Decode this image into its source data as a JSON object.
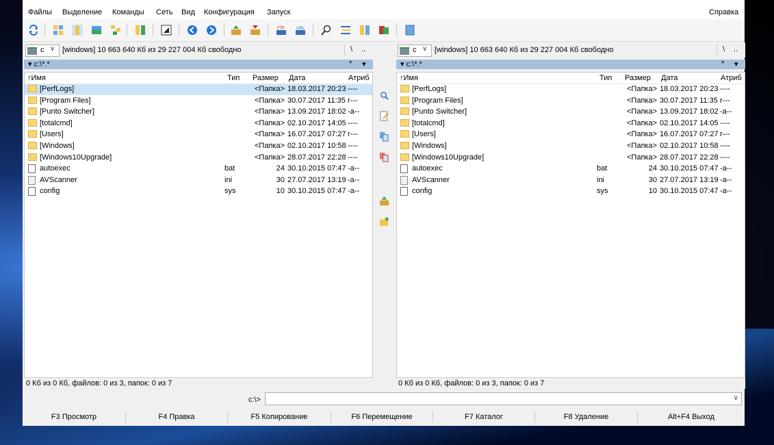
{
  "menu": {
    "files": "Файлы",
    "selection": "Выделение",
    "commands": "Команды",
    "network": "Сеть",
    "view": "Вид",
    "configuration": "Конфигурация",
    "launch": "Запуск",
    "help": "Справка"
  },
  "left_panel": {
    "drive": "c",
    "free_space": "[windows]  10 663 640 Кб из 29 227 004 Кб свободно",
    "root": "\\",
    "up": "..",
    "path": "c:\\*.*",
    "filter": "*",
    "headers": {
      "name": "Имя",
      "ext": "Тип",
      "size": "Размер",
      "date": "Дата",
      "attr": "Атриб"
    },
    "rows": [
      {
        "name": "[PerfLogs]",
        "ext": "",
        "size": "<Папка>",
        "date": "18.03.2017 20:23",
        "attr": "----",
        "icon": "folder-icon"
      },
      {
        "name": "[Program Files]",
        "ext": "",
        "size": "<Папка>",
        "date": "30.07.2017 11:35",
        "attr": "r---",
        "icon": "folder-icon"
      },
      {
        "name": "[Punto Switcher]",
        "ext": "",
        "size": "<Папка>",
        "date": "13.09.2017 18:02",
        "attr": "-a--",
        "icon": "folder-icon"
      },
      {
        "name": "[totalcmd]",
        "ext": "",
        "size": "<Папка>",
        "date": "02.10.2017 14:05",
        "attr": "----",
        "icon": "folder-icon"
      },
      {
        "name": "[Users]",
        "ext": "",
        "size": "<Папка>",
        "date": "16.07.2017 07:27",
        "attr": "r---",
        "icon": "folder-icon"
      },
      {
        "name": "[Windows]",
        "ext": "",
        "size": "<Папка>",
        "date": "02.10.2017 10:58",
        "attr": "----",
        "icon": "folder-icon"
      },
      {
        "name": "[Windows10Upgrade]",
        "ext": "",
        "size": "<Папка>",
        "date": "28.07.2017 22:28",
        "attr": "----",
        "icon": "folder-icon"
      },
      {
        "name": "autoexec",
        "ext": "bat",
        "size": "24",
        "date": "30.10.2015 07:47",
        "attr": "-a--",
        "icon": "batch-file-icon"
      },
      {
        "name": "AVScanner",
        "ext": "ini",
        "size": "30",
        "date": "27.07.2017 13:19",
        "attr": "-a--",
        "icon": "settings-file-icon"
      },
      {
        "name": "config",
        "ext": "sys",
        "size": "10",
        "date": "30.10.2015 07:47",
        "attr": "-a--",
        "icon": "file-icon"
      }
    ],
    "status": "0 Кб из 0 Кб, файлов: 0 из 3, папок: 0 из 7"
  },
  "right_panel": {
    "drive": "c",
    "free_space": "[windows]  10 663 640 Кб из 29 227 004 Кб свободно",
    "root": "\\",
    "up": "..",
    "path": "c:\\*.*",
    "filter": "*",
    "headers": {
      "name": "Имя",
      "ext": "Тип",
      "size": "Размер",
      "date": "Дата",
      "attr": "Атриб"
    },
    "rows": [
      {
        "name": "[PerfLogs]",
        "ext": "",
        "size": "<Папка>",
        "date": "18.03.2017 20:23",
        "attr": "----",
        "icon": "folder-icon"
      },
      {
        "name": "[Program Files]",
        "ext": "",
        "size": "<Папка>",
        "date": "30.07.2017 11:35",
        "attr": "r---",
        "icon": "folder-icon"
      },
      {
        "name": "[Punto Switcher]",
        "ext": "",
        "size": "<Папка>",
        "date": "13.09.2017 18:02",
        "attr": "-a--",
        "icon": "folder-icon"
      },
      {
        "name": "[totalcmd]",
        "ext": "",
        "size": "<Папка>",
        "date": "02.10.2017 14:05",
        "attr": "----",
        "icon": "folder-icon"
      },
      {
        "name": "[Users]",
        "ext": "",
        "size": "<Папка>",
        "date": "16.07.2017 07:27",
        "attr": "r---",
        "icon": "folder-icon"
      },
      {
        "name": "[Windows]",
        "ext": "",
        "size": "<Папка>",
        "date": "02.10.2017 10:58",
        "attr": "----",
        "icon": "folder-icon"
      },
      {
        "name": "[Windows10Upgrade]",
        "ext": "",
        "size": "<Папка>",
        "date": "28.07.2017 22:28",
        "attr": "----",
        "icon": "folder-icon"
      },
      {
        "name": "autoexec",
        "ext": "bat",
        "size": "24",
        "date": "30.10.2015 07:47",
        "attr": "-a--",
        "icon": "batch-file-icon"
      },
      {
        "name": "AVScanner",
        "ext": "ini",
        "size": "30",
        "date": "27.07.2017 13:19",
        "attr": "-a--",
        "icon": "settings-file-icon"
      },
      {
        "name": "config",
        "ext": "sys",
        "size": "10",
        "date": "30.10.2015 07:47",
        "attr": "-a--",
        "icon": "file-icon"
      }
    ],
    "status": "0 Кб из 0 Кб, файлов: 0 из 3, папок: 0 из 7"
  },
  "command_line": {
    "prompt": "c:\\>"
  },
  "fkeys": {
    "f3": "F3 Просмотр",
    "f4": "F4 Правка",
    "f5": "F5 Копирование",
    "f6": "F6 Перемещение",
    "f7": "F7 Каталог",
    "f8": "F8 Удаление",
    "altf4": "Alt+F4 Выход"
  },
  "colors": {
    "selection": "#cce4f7",
    "path_bar": "#a6c0dc",
    "folder": "#f7d674",
    "accent_blue": "#1e73d2"
  }
}
